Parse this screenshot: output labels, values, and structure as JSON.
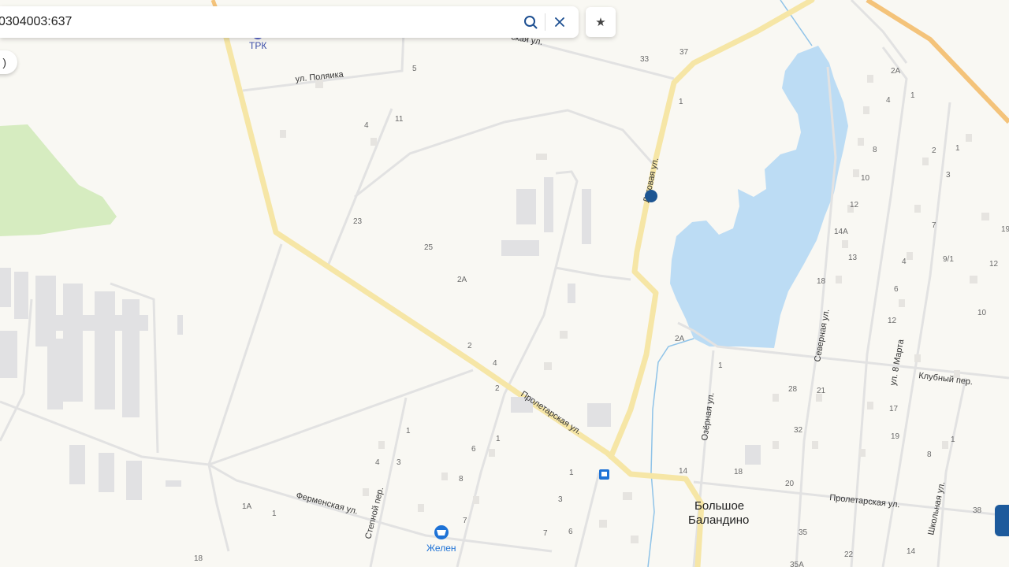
{
  "search": {
    "value": "0304003:637",
    "search_icon": "search-icon",
    "clear_icon": "close-icon"
  },
  "bookmark": {
    "icon": "star-icon",
    "glyph": "★"
  },
  "left_control": {
    "label": ")"
  },
  "map": {
    "town": {
      "line1": "Большое",
      "line2": "Баландино"
    },
    "poi": {
      "trk": "ТРК",
      "shop": "Желен"
    },
    "streets": {
      "polyanka": "ул. Поляика",
      "lugovaya": "Луговая ул.",
      "proletarskaya_mid": "Пролетарская ул.",
      "proletarskaya_east": "Пролетарская ул.",
      "severnaya": "Северная ул.",
      "ozernaya": "Озёрная ул.",
      "marta": "ул. 8 Марта",
      "klubny": "Клубный пер.",
      "shkolnaya": "Школьная ул.",
      "fermenskaya": "Ферменская ул.",
      "stepnoy": "Степной пер.",
      "top_cut": "ская ул."
    },
    "numbers": {
      "n33": "33",
      "n37": "37",
      "n5": "5",
      "n1a": "1",
      "n11": "11",
      "n4a": "4",
      "n23": "23",
      "n25": "25",
      "n2A_mid": "2А",
      "n2_road": "2",
      "n4_road": "4",
      "n2_road2": "2",
      "n2A_lake": "2А",
      "n1_oz": "1",
      "n2A_top": "2А",
      "n4_top": "4",
      "n1_top": "1",
      "n8": "8",
      "n10": "10",
      "n12": "12",
      "n14A": "14А",
      "n13": "13",
      "n18": "18",
      "n2_r": "2",
      "n1_r": "1",
      "n3_r": "3",
      "n7_r": "7",
      "n4_r": "4",
      "n9_1": "9/1",
      "n12_r": "12",
      "n6_r": "6",
      "n12_r2": "12",
      "n10_r": "10",
      "n19_r": "19",
      "n28": "28",
      "n21": "21",
      "n17": "17",
      "n32": "32",
      "n19": "19",
      "n1_mid": "1",
      "n8_r2": "8",
      "n14": "14",
      "n18b": "18",
      "n20": "20",
      "n35": "35",
      "n22": "22",
      "n14b": "14",
      "n35A": "35А",
      "n38": "38",
      "n1_s": "1",
      "n4_s": "4",
      "n3_s": "3",
      "n1_s2": "1",
      "n6_s": "6",
      "n8_s": "8",
      "n7_s": "7",
      "n1_s3": "1",
      "n3_s2": "3",
      "n7_s2": "7",
      "n6_s2": "6",
      "n1A": "1А",
      "n1_f": "1",
      "n18_f": "18"
    }
  },
  "colors": {
    "background": "#f9f8f3",
    "water": "#bcdcf4",
    "main_road": "#f6e6a6",
    "park": "#d6ecc0",
    "building": "#e3e3e3",
    "accent": "#1d4f91"
  }
}
